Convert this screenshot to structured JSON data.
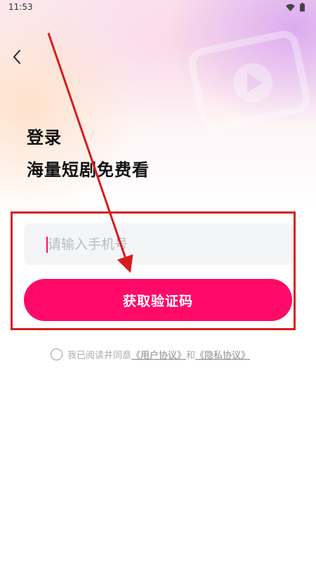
{
  "status_bar": {
    "time": "11:53",
    "icons": [
      "wifi-icon",
      "battery-icon"
    ]
  },
  "header": {
    "back_icon": "chevron-left-icon",
    "title": "登录",
    "subtitle": "海量短剧免费看"
  },
  "form": {
    "phone_placeholder": "请输入手机号",
    "phone_value": "",
    "submit_label": "获取验证码"
  },
  "agreement": {
    "prefix": "我已阅读并同意",
    "user_agreement": "《用户协议》",
    "and": "和",
    "privacy_policy": "《隐私协议》"
  },
  "colors": {
    "accent": "#ff0a68",
    "annotation": "#d61c1c"
  }
}
